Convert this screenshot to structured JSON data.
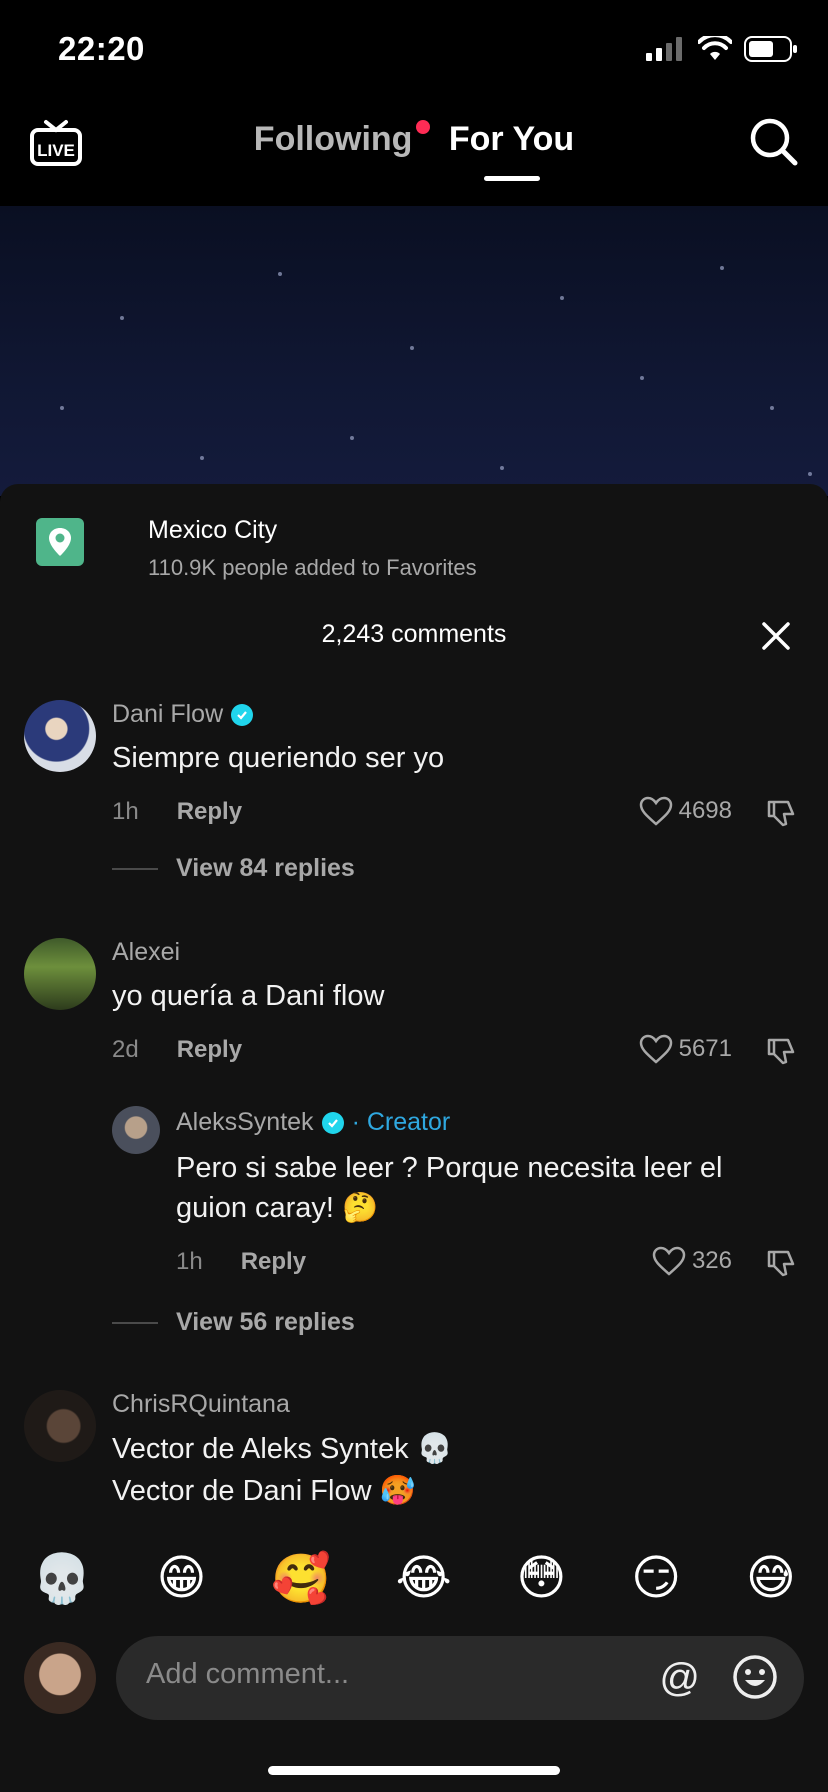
{
  "status": {
    "time": "22:20"
  },
  "nav": {
    "tab_following": "Following",
    "tab_foryou": "For You",
    "live_label": "LIVE"
  },
  "place": {
    "name": "Mexico City",
    "sub": "110.9K people added to Favorites"
  },
  "comments_count": "2,243 comments",
  "comments": [
    {
      "user": "Dani Flow",
      "verified": true,
      "text": "Siempre queriendo ser yo",
      "time": "1h",
      "reply": "Reply",
      "likes": "4698",
      "view_replies": "View 84 replies"
    },
    {
      "user": "Alexei",
      "verified": false,
      "text": "yo quería a Dani flow",
      "time": "2d",
      "reply": "Reply",
      "likes": "5671",
      "sub_reply": {
        "user": "AleksSyntek",
        "verified": true,
        "creator": "· Creator",
        "text_line1": "Pero si sabe leer ? Porque necesita leer el",
        "text_line2": "guion caray! 🤔",
        "time": "1h",
        "reply": "Reply",
        "likes": "326"
      },
      "view_replies": "View 56 replies"
    },
    {
      "user": "ChrisRQuintana",
      "verified": false,
      "text_line1": "Vector de Aleks Syntek 💀",
      "text_line2": "Vector de Dani Flow 🥵"
    }
  ],
  "emojis": [
    "💀",
    "😁",
    "🥰",
    "😂",
    "😳",
    "😏",
    "😅"
  ],
  "input": {
    "placeholder": "Add comment...",
    "at": "@"
  },
  "colors": {
    "accent_red": "#fe2c55",
    "verified": "#20d5ec",
    "creator": "#2fa8e0",
    "place_icon": "#4fb58a"
  }
}
